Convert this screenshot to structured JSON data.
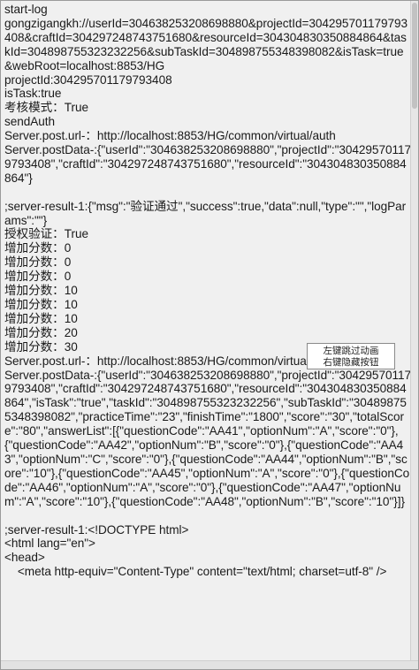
{
  "log": {
    "lines": [
      "start-log",
      "gongzigangkh://userId=304638253208698880&projectId=304295701179793408&craftId=304297248743751680&resourceId=304304830350884864&taskId=304898755323232256&subTaskId=304898755348398082&isTask=true&webRoot=localhost:8853/HG",
      "projectId:304295701179793408",
      "isTask:true",
      "考核模式：True",
      "sendAuth",
      "Server.post.url-：http://localhost:8853/HG/common/virtual/auth",
      "Server.postData-:{\"userId\":\"304638253208698880\",\"projectId\":\"304295701179793408\",\"craftId\":\"304297248743751680\",\"resourceId\":\"304304830350884864\"}",
      "",
      ";server-result-1:{\"msg\":\"验证通过\",\"success\":true,\"data\":null,\"type\":\"\",\"logParams\":\"\"}",
      "授权验证：True",
      "增加分数：0",
      "增加分数：0",
      "增加分数：0",
      "增加分数：10",
      "增加分数：10",
      "增加分数：10",
      "增加分数：20",
      "增加分数：30",
      "Server.post.url-：http://localhost:8853/HG/common/virtual/result/save",
      "Server.postData-:{\"userId\":\"304638253208698880\",\"projectId\":\"304295701179793408\",\"craftId\":\"304297248743751680\",\"resourceId\":\"304304830350884864\",\"isTask\":\"true\",\"taskId\":\"304898755323232256\",\"subTaskId\":\"304898755348398082\",\"practiceTime\":\"23\",\"finishTime\":\"1800\",\"score\":\"30\",\"totalScore\":\"80\",\"answerList\":[{\"questionCode\":\"AA41\",\"optionNum\":\"A\",\"score\":\"0\"},{\"questionCode\":\"AA42\",\"optionNum\":\"B\",\"score\":\"0\"},{\"questionCode\":\"AA43\",\"optionNum\":\"C\",\"score\":\"0\"},{\"questionCode\":\"AA44\",\"optionNum\":\"B\",\"score\":\"10\"},{\"questionCode\":\"AA45\",\"optionNum\":\"A\",\"score\":\"0\"},{\"questionCode\":\"AA46\",\"optionNum\":\"A\",\"score\":\"0\"},{\"questionCode\":\"AA47\",\"optionNum\":\"A\",\"score\":\"10\"},{\"questionCode\":\"AA48\",\"optionNum\":\"B\",\"score\":\"10\"}]}",
      "",
      ";server-result-1:<!DOCTYPE html>",
      "<html lang=\"en\">",
      "<head>",
      "    <meta http-equiv=\"Content-Type\" content=\"text/html; charset=utf-8\" />"
    ]
  },
  "hint": {
    "line1": "左键跳过动画",
    "line2": "右键隐藏按钮"
  }
}
